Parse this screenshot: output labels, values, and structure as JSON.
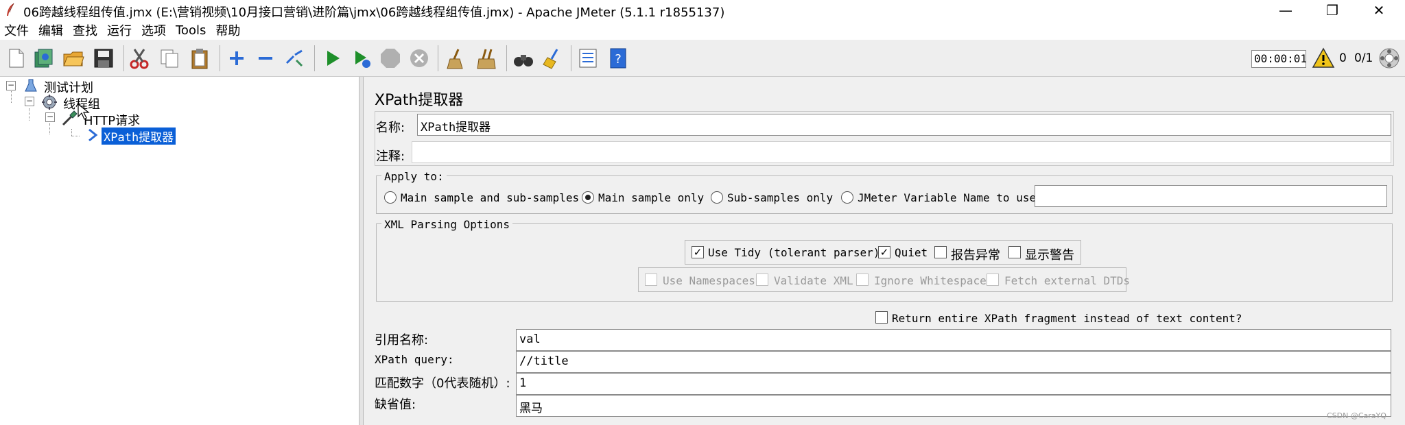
{
  "window": {
    "title": "06跨越线程组传值.jmx (E:\\营销视频\\10月接口营销\\进阶篇\\jmx\\06跨越线程组传值.jmx) - Apache JMeter (5.1.1 r1855137)",
    "minimize": "—",
    "maximize": "❐",
    "close": "✕"
  },
  "menu": [
    "文件",
    "编辑",
    "查找",
    "运行",
    "选项",
    "Tools",
    "帮助"
  ],
  "toolbar": {
    "timer": "00:00:01",
    "warnings": "0",
    "threads": "0/1"
  },
  "tree": {
    "plan": "测试计划",
    "thread_group": "线程组",
    "http_request": "HTTP请求",
    "extractor": "XPath提取器"
  },
  "panel": {
    "title": "XPath提取器",
    "name_label": "名称:",
    "name_value": "XPath提取器",
    "comment_label": "注释:",
    "comment_value": "",
    "apply_to": {
      "title": "Apply to:",
      "options": [
        "Main sample and sub-samples",
        "Main sample only",
        "Sub-samples only",
        "JMeter Variable Name to use"
      ],
      "selected": 1,
      "variable_value": ""
    },
    "xml_parsing": {
      "title": "XML Parsing Options",
      "use_tidy": "Use Tidy (tolerant parser)",
      "quiet": "Quiet",
      "report_errors": "报告异常",
      "show_warnings": "显示警告",
      "use_namespaces": "Use Namespaces",
      "validate_xml": "Validate XML",
      "ignore_whitespace": "Ignore Whitespace",
      "fetch_dtds": "Fetch external DTDs"
    },
    "return_fragment": "Return entire XPath fragment instead of text content?",
    "ref_name_label": "引用名称:",
    "ref_name_value": "val",
    "xpath_label": "XPath query:",
    "xpath_value": "//title",
    "match_label": "匹配数字（0代表随机）:",
    "match_value": "1",
    "default_label": "缺省值:",
    "default_value": "黑马"
  },
  "watermark": "CSDN @CaraYQ",
  "colors": {
    "selection": "#0a5fd7",
    "run_green": "#1e8f2a",
    "help_blue": "#2b6bd6"
  }
}
